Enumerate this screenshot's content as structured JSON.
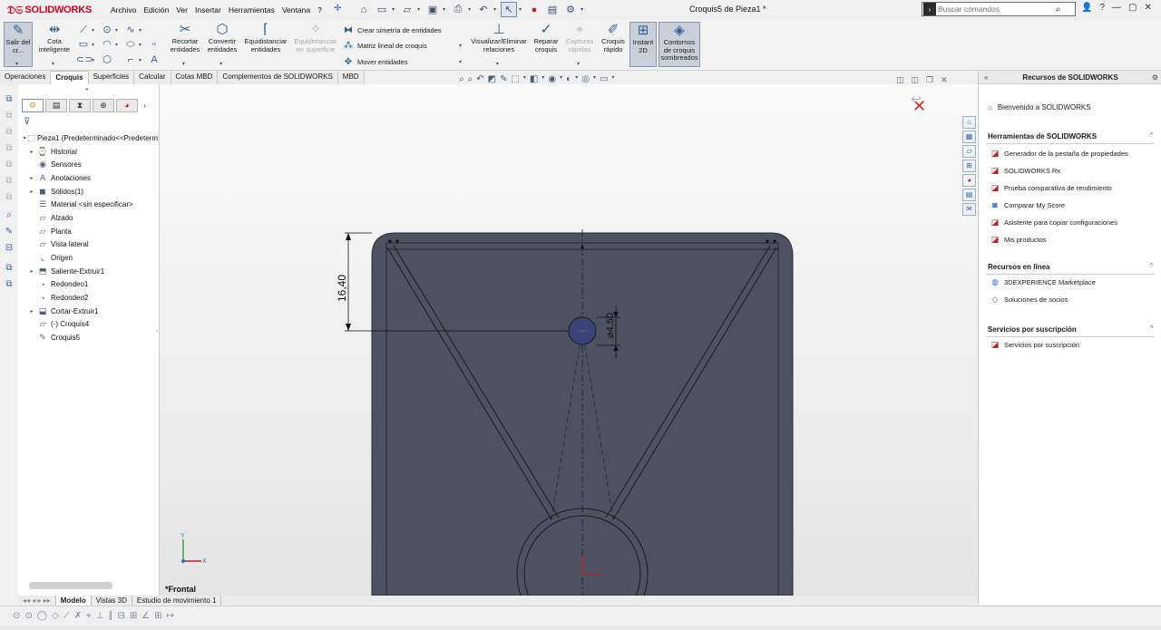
{
  "app": {
    "brand": "SOLIDWORKS",
    "doc_title": "Croquis5 de Pieza1 *"
  },
  "menu": [
    "Archivo",
    "Edición",
    "Ver",
    "Insertar",
    "Herramientas",
    "Ventana",
    "?"
  ],
  "search": {
    "placeholder": "Buscar comandos"
  },
  "command_manager": {
    "exit_sketch": "Salir del cr...",
    "smart_dimension": "Cota inteligente",
    "trim": "Recortar entidades",
    "convert": "Convertir entidades",
    "offset": "Equidistanciar entidades",
    "offset_surface": "Equidistanciar en superficie",
    "mirror": "Crear simetría de entidades",
    "linear_pattern": "Matriz lineal de croquis",
    "move": "Mover entidades",
    "relations": "Visualizar/Eliminar relaciones",
    "repair": "Reparar croquis",
    "quick_snaps": "Capturas rápidas",
    "rapid_sketch": "Croquis rápido",
    "instant2d": "Instant 2D",
    "shaded_contours": "Contornos de croquis sombreados"
  },
  "tabs": [
    "Operaciones",
    "Croquis",
    "Superficies",
    "Calcular",
    "Cotas MBD",
    "Complementos de SOLIDWORKS",
    "MBD"
  ],
  "active_tab": "Croquis",
  "feature_tree": [
    {
      "label": "Pieza1  (Predeterminado<<Predeterm",
      "icon": "part",
      "indent": 0,
      "expander": "-"
    },
    {
      "label": "Historial",
      "icon": "history",
      "indent": 1,
      "expander": "▸"
    },
    {
      "label": "Sensores",
      "icon": "sensor",
      "indent": 1,
      "expander": ""
    },
    {
      "label": "Anotaciones",
      "icon": "annotation",
      "indent": 1,
      "expander": "▸"
    },
    {
      "label": "Sólidos(1)",
      "icon": "solid",
      "indent": 1,
      "expander": "▸"
    },
    {
      "label": "Material <sin especificar>",
      "icon": "material",
      "indent": 1,
      "expander": ""
    },
    {
      "label": "Alzado",
      "icon": "plane",
      "indent": 1,
      "expander": ""
    },
    {
      "label": "Planta",
      "icon": "plane",
      "indent": 1,
      "expander": ""
    },
    {
      "label": "Vista lateral",
      "icon": "plane",
      "indent": 1,
      "expander": ""
    },
    {
      "label": "Origen",
      "icon": "origin",
      "indent": 1,
      "expander": ""
    },
    {
      "label": "Saliente-Extruir1",
      "icon": "extrude",
      "indent": 1,
      "expander": "▸"
    },
    {
      "label": "Redondeo1",
      "icon": "fillet",
      "indent": 1,
      "expander": ""
    },
    {
      "label": "Redondeo2",
      "icon": "fillet",
      "indent": 1,
      "expander": ""
    },
    {
      "label": "Cortar-Extruir1",
      "icon": "cut",
      "indent": 1,
      "expander": "▸"
    },
    {
      "label": "(-) Croquis4",
      "icon": "sketch",
      "indent": 1,
      "expander": ""
    },
    {
      "label": "Croquis5",
      "icon": "sketch-edit",
      "indent": 1,
      "expander": ""
    }
  ],
  "graphics": {
    "view_label": "*Frontal",
    "dim_vertical": "16,40",
    "dim_diameter": "⌀4,50",
    "triad_y": "Y",
    "triad_x": "X"
  },
  "resources": {
    "title": "Recursos de SOLIDWORKS",
    "welcome": "Bienvenido a SOLIDWORKS",
    "sections": [
      {
        "title": "Herramientas de SOLIDWORKS",
        "items": [
          "Generador de la pestaña de propiedades",
          "SOLIDWORKS Rx",
          "Prueba comparativa de rendimiento",
          "Comparar My Score",
          "Asistente para copiar configuraciones",
          "Mis productos"
        ]
      },
      {
        "title": "Recursos en línea",
        "items": [
          "3DEXPERIENCE Marketplace",
          "Soluciones de socios"
        ]
      },
      {
        "title": "Servicios por suscripción",
        "items": [
          "Servicios por suscripción"
        ]
      }
    ]
  },
  "bottom_tabs": [
    "Modelo",
    "Vistas 3D",
    "Estudio de movimiento 1"
  ],
  "colors": {
    "part_fill": "#4e5260",
    "accent": "#2a6ac8",
    "brand_red": "#d6001c"
  }
}
